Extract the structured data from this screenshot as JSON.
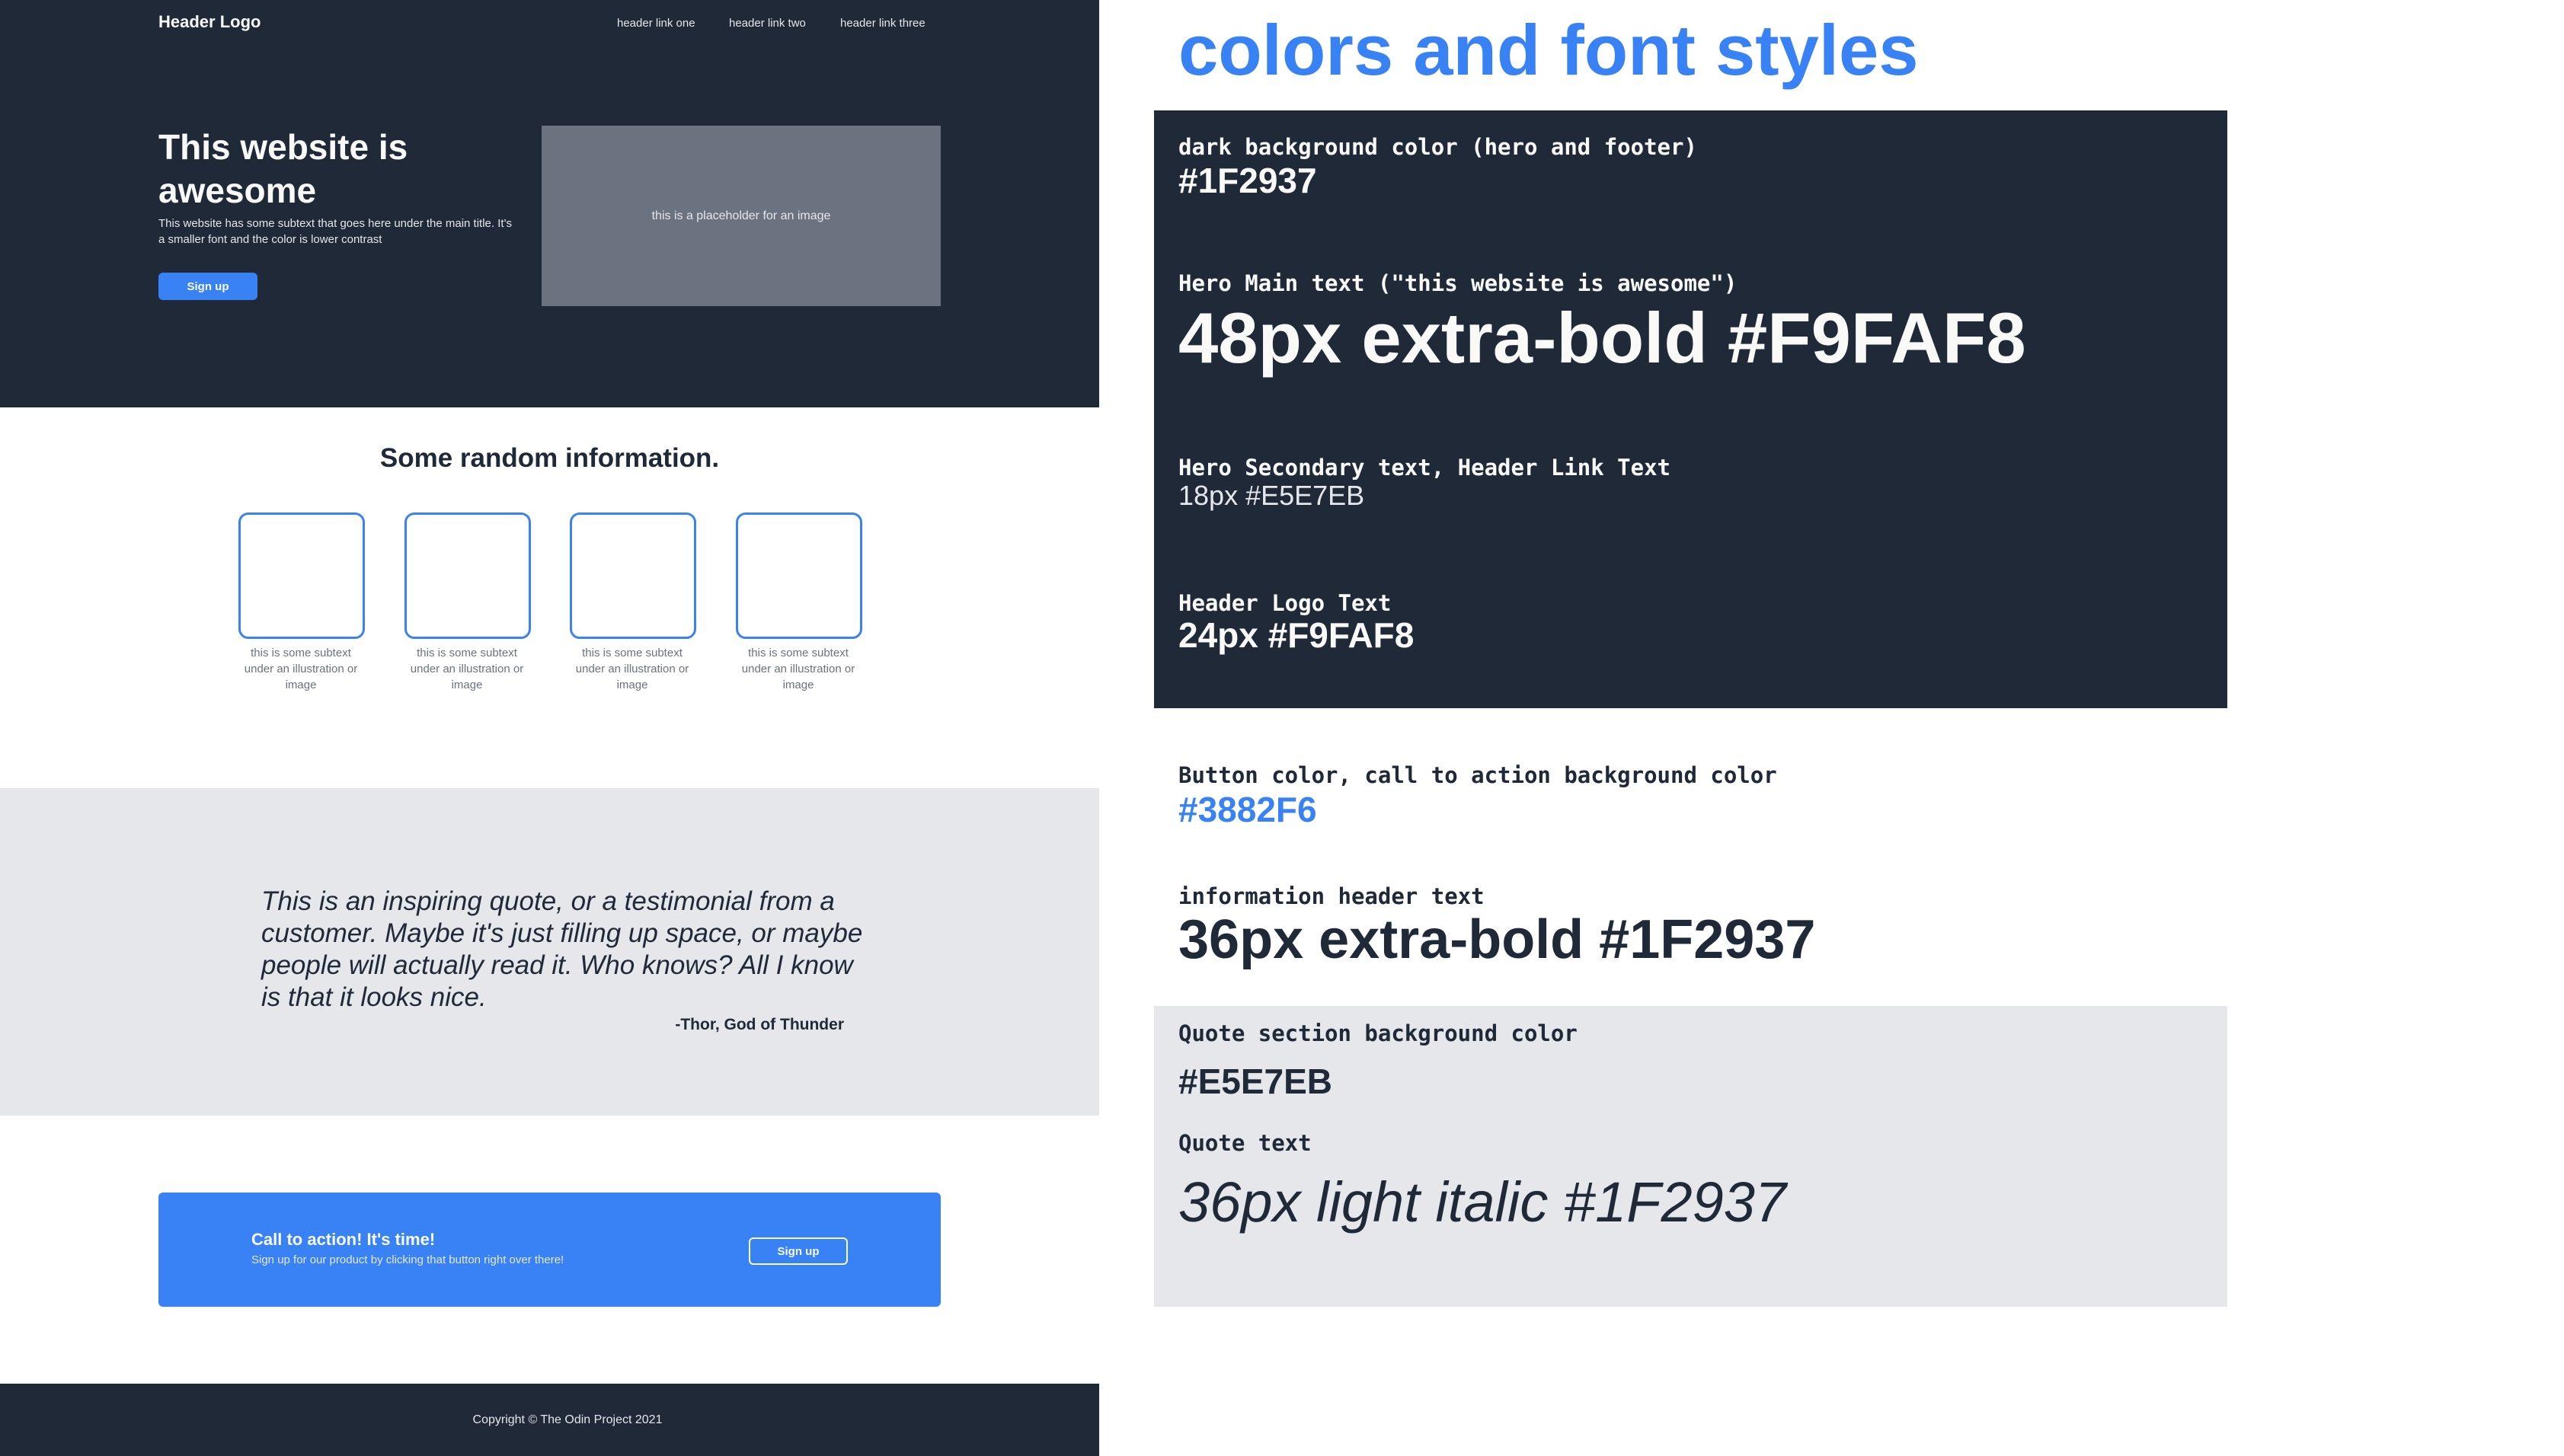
{
  "header": {
    "logo": "Header Logo",
    "links": [
      "header link one",
      "header link two",
      "header link three"
    ]
  },
  "hero": {
    "title": "This website is awesome",
    "subtext": "This website has some subtext that goes here under the main title.  It's a smaller font and the color is lower contrast",
    "button": "Sign up",
    "image_placeholder": "this is a placeholder for an image"
  },
  "info": {
    "title": "Some random information.",
    "cards": [
      {
        "text": "this is some subtext under an illustration or image"
      },
      {
        "text": "this is some subtext under an illustration or image"
      },
      {
        "text": "this is some subtext under an illustration or image"
      },
      {
        "text": "this is some subtext under an illustration or image"
      }
    ]
  },
  "quote": {
    "text": "This is an inspiring quote, or a testimonial from a customer.  Maybe it's just filling up space, or maybe people will actually read it. Who knows?  All I know is that it looks nice.",
    "author": "-Thor, God of Thunder"
  },
  "cta": {
    "title": "Call to action! It's time!",
    "subtext": "Sign up for our product by clicking that button right over there!",
    "button": "Sign up"
  },
  "footer": {
    "text": "Copyright  ©  The Odin Project 2021"
  },
  "style_guide": {
    "title": "colors and font styles",
    "items": [
      {
        "label": "dark background color (hero and footer)",
        "value": "#1F2937"
      },
      {
        "label": "Hero Main text (\"this website is awesome\")",
        "value": "48px extra-bold #F9FAF8"
      },
      {
        "label": "Hero Secondary text, Header Link Text",
        "value": "18px #E5E7EB"
      },
      {
        "label": "Header Logo Text",
        "value": "24px #F9FAF8"
      },
      {
        "label": "Button color, call to action background color",
        "value": "#3882F6"
      },
      {
        "label": "information header text",
        "value": "36px extra-bold #1F2937"
      },
      {
        "label": "Quote section background color",
        "value": "#E5E7EB"
      },
      {
        "label": "Quote text",
        "value": "36px light italic #1F2937"
      }
    ]
  },
  "colors": {
    "dark": "#1F2937",
    "blue": "#3882F6",
    "light_gray": "#E5E7EB",
    "off_white": "#F9FAF8",
    "placeholder_gray": "#6B7280"
  }
}
